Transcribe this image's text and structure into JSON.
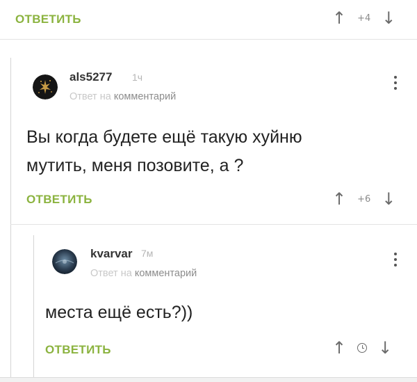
{
  "top_comment": {
    "reply_label": "ОТВЕТИТЬ",
    "score": "+4",
    "up_icon": "arrow-up-icon",
    "down_icon": "arrow-down-icon"
  },
  "comment1": {
    "username": "als5277",
    "time": "1ч",
    "reply_to_prefix": "Ответ на",
    "reply_to_target": "комментарий",
    "text_line1": "Вы когда будете ещё такую хуйню",
    "text_line2": "мутить, меня позовите, а ?",
    "reply_label": "ОТВЕТИТЬ",
    "score": "+6",
    "avatar_icon": "avatar-dark-glitter"
  },
  "comment2": {
    "username": "kvarvar",
    "time": "7м",
    "reply_to_prefix": "Ответ на",
    "reply_to_target": "комментарий",
    "text": "места ещё есть?))",
    "reply_label": "ОТВЕТИТЬ",
    "score_icon": "clock-icon",
    "avatar_icon": "avatar-dark-blue"
  },
  "colors": {
    "accent_green": "#8bb33f",
    "text": "#222222",
    "muted": "#b5b5b5"
  }
}
